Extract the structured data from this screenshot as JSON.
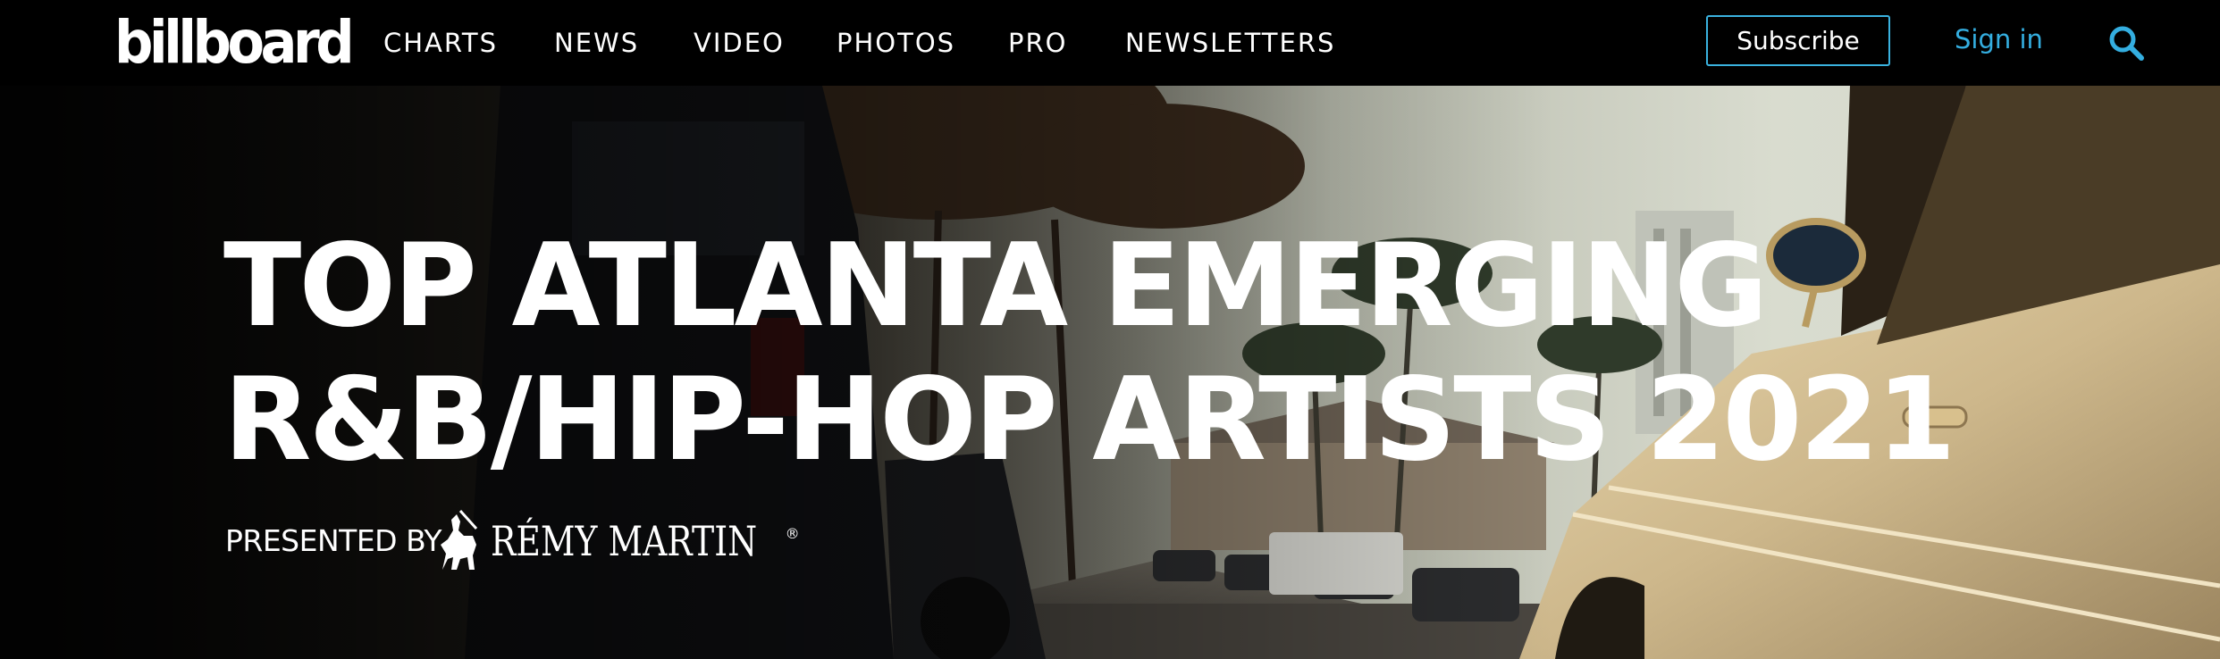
{
  "header": {
    "logo_text": "billboard",
    "nav": [
      {
        "label": "CHARTS"
      },
      {
        "label": "NEWS"
      },
      {
        "label": "VIDEO"
      },
      {
        "label": "PHOTOS"
      },
      {
        "label": "PRO"
      },
      {
        "label": "NEWSLETTERS"
      }
    ],
    "subscribe_label": "Subscribe",
    "signin_label": "Sign in",
    "search_icon": "search-icon",
    "accent_color": "#34aee0"
  },
  "hero": {
    "title_line1": "TOP ATLANTA EMERGING",
    "title_line2": "R&B/HIP-HOP ARTISTS 2021",
    "presented_by": "PRESENTED BY",
    "sponsor_name": "RÉMY MARTIN",
    "sponsor_mark": "®",
    "background": "street scene with parked cars, palm trees and a vintage cream car"
  }
}
